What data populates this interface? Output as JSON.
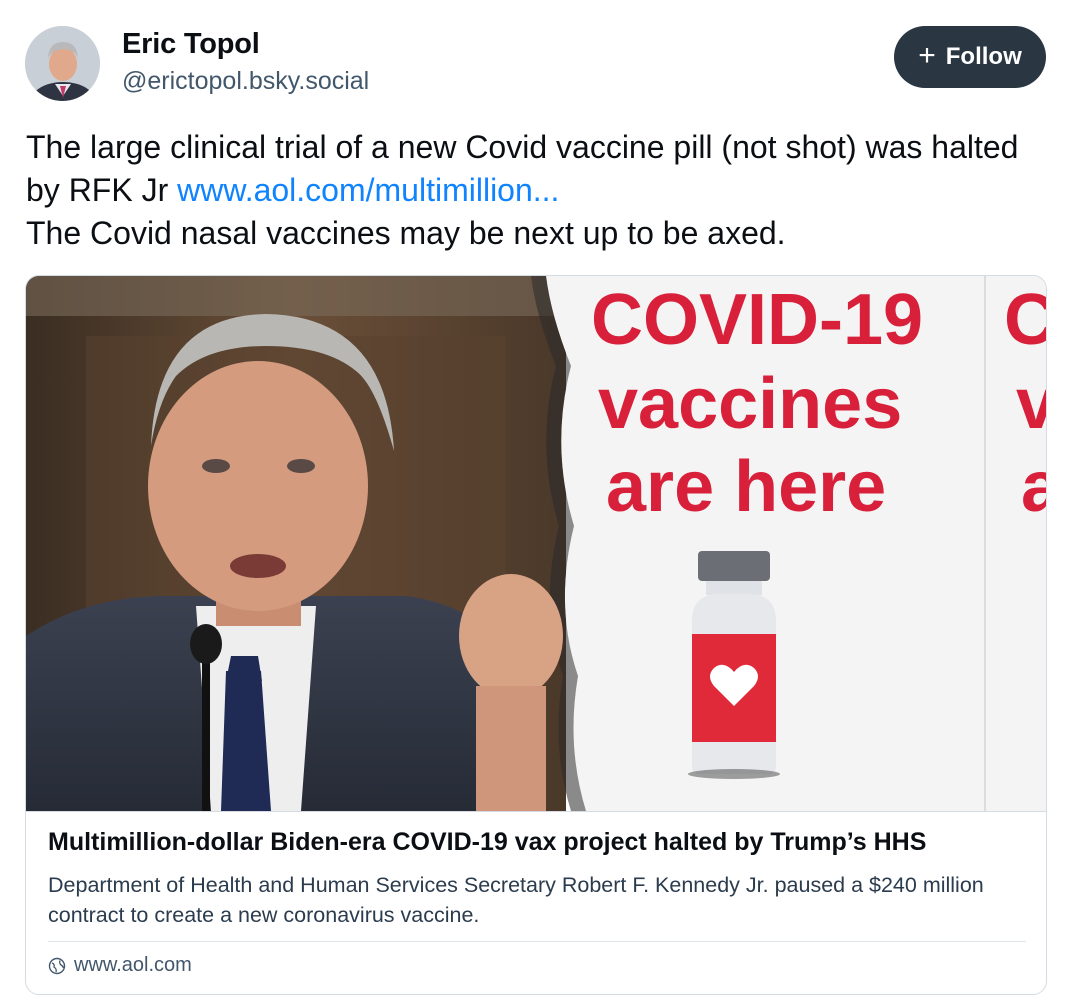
{
  "author": {
    "display_name": "Eric Topol",
    "handle": "@erictopol.bsky.social"
  },
  "follow_button": {
    "icon": "plus-icon",
    "label": "Follow"
  },
  "post": {
    "text_part1": "The large clinical trial of a new Covid vaccine pill (not shot) was halted by RFK Jr ",
    "link_text": "www.aol.com/multimillion...",
    "text_part2": "The Covid nasal vaccines may be next up to be axed."
  },
  "link_card": {
    "image": {
      "sign_line1": "COVID-19",
      "sign_line2": "vaccines",
      "sign_line3": "are here",
      "partial_line1": "C",
      "partial_line2": "v",
      "partial_line3": "a"
    },
    "title": "Multimillion-dollar Biden-era COVID-19 vax project halted by Trump’s HHS",
    "description": "Department of Health and Human Services Secretary Robert F. Kennedy Jr. paused a $240 million contract to create a new coronavirus vaccine.",
    "domain": "www.aol.com",
    "domain_icon": "globe-icon"
  },
  "colors": {
    "link": "#1083fe",
    "follow_bg": "#2a3642",
    "sign_red": "#d8203a"
  }
}
